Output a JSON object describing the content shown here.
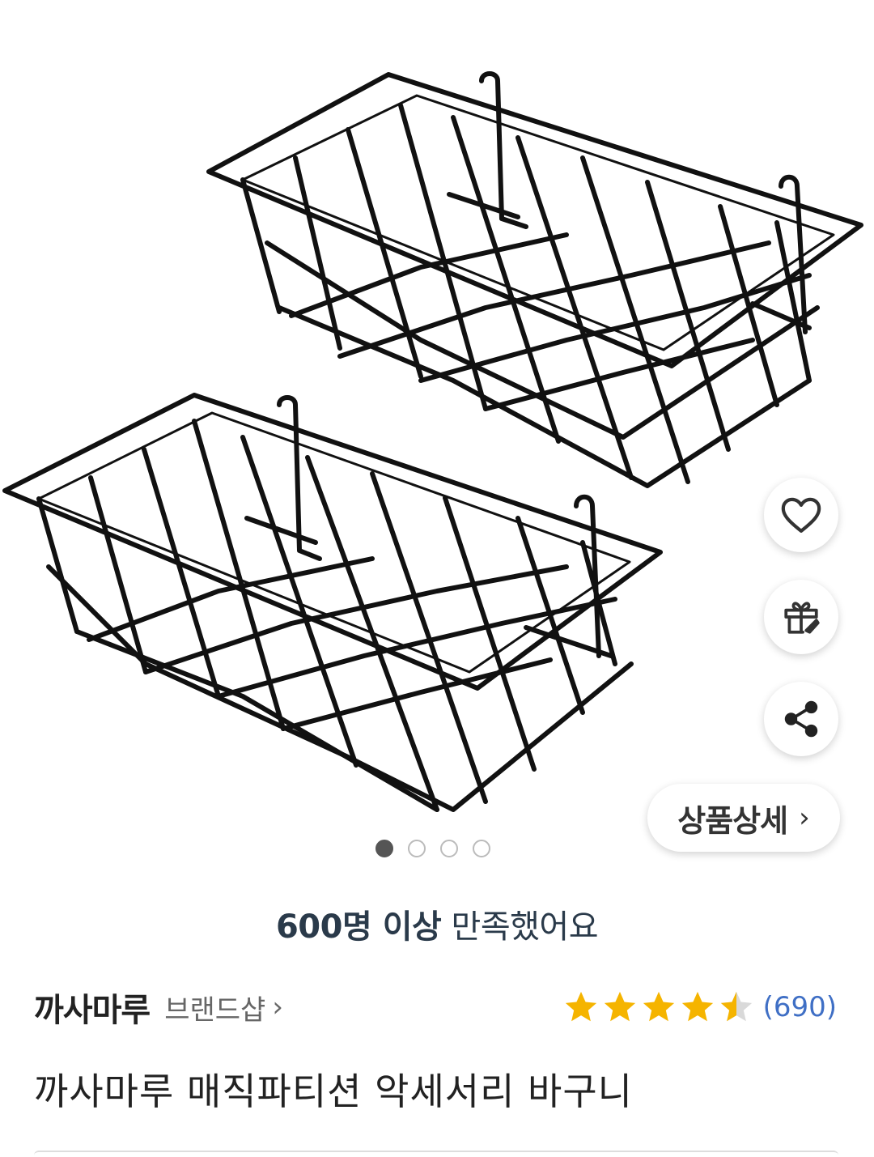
{
  "product": {
    "image_alt": "wire basket product photo",
    "gallery": {
      "current_index": 1,
      "total": 4
    },
    "detail_button_label": "상품상세",
    "satisfaction": {
      "strong": "600명 이상",
      "rest": "만족했어요"
    },
    "brand": {
      "name": "까사마루",
      "shop_link": "브랜드샵"
    },
    "rating": {
      "stars": 4.5,
      "review_count": "(690)"
    },
    "title": "까사마루 매직파티션 악세서리 바구니"
  },
  "actions": {
    "wishlist_icon": "heart-icon",
    "gift_icon": "gift-icon",
    "share_icon": "share-icon"
  },
  "colors": {
    "star": "#f5b400",
    "star_empty": "#d9d9d9",
    "review_link": "#3f6fc5",
    "basket": "#111111"
  }
}
